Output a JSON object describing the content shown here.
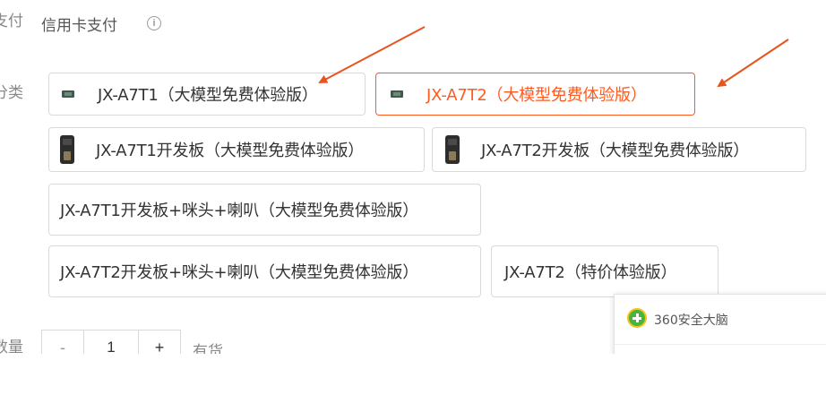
{
  "payment": {
    "label": "支付",
    "value": "信用卡支付",
    "info_icon": "info-circle-icon"
  },
  "variant": {
    "label": "分类",
    "options": [
      {
        "label": "JX-A7T1（大模型免费体验版）",
        "icon": "chip-icon",
        "selected": false
      },
      {
        "label": "JX-A7T2（大模型免费体验版）",
        "icon": "chip-icon",
        "selected": true
      },
      {
        "label": "JX-A7T1开发板（大模型免费体验版）",
        "icon": "board-icon",
        "selected": false
      },
      {
        "label": "JX-A7T2开发板（大模型免费体验版）",
        "icon": "board-icon",
        "selected": false
      },
      {
        "label": "JX-A7T1开发板+咪头+喇叭（大模型免费体验版）",
        "selected": false
      },
      {
        "label": "JX-A7T2开发板+咪头+喇叭（大模型免费体验版）",
        "selected": false
      },
      {
        "label": "JX-A7T2（特价体验版）",
        "selected": false
      }
    ]
  },
  "quantity": {
    "label": "数量",
    "minus": "-",
    "value": "1",
    "plus": "+",
    "stock": "有货"
  },
  "popup": {
    "title": "360安全大脑",
    "icon": "360-logo-icon"
  },
  "colors": {
    "accent": "#ff5a1f",
    "border": "#d9d9d9",
    "arrow": "#e8541e"
  }
}
